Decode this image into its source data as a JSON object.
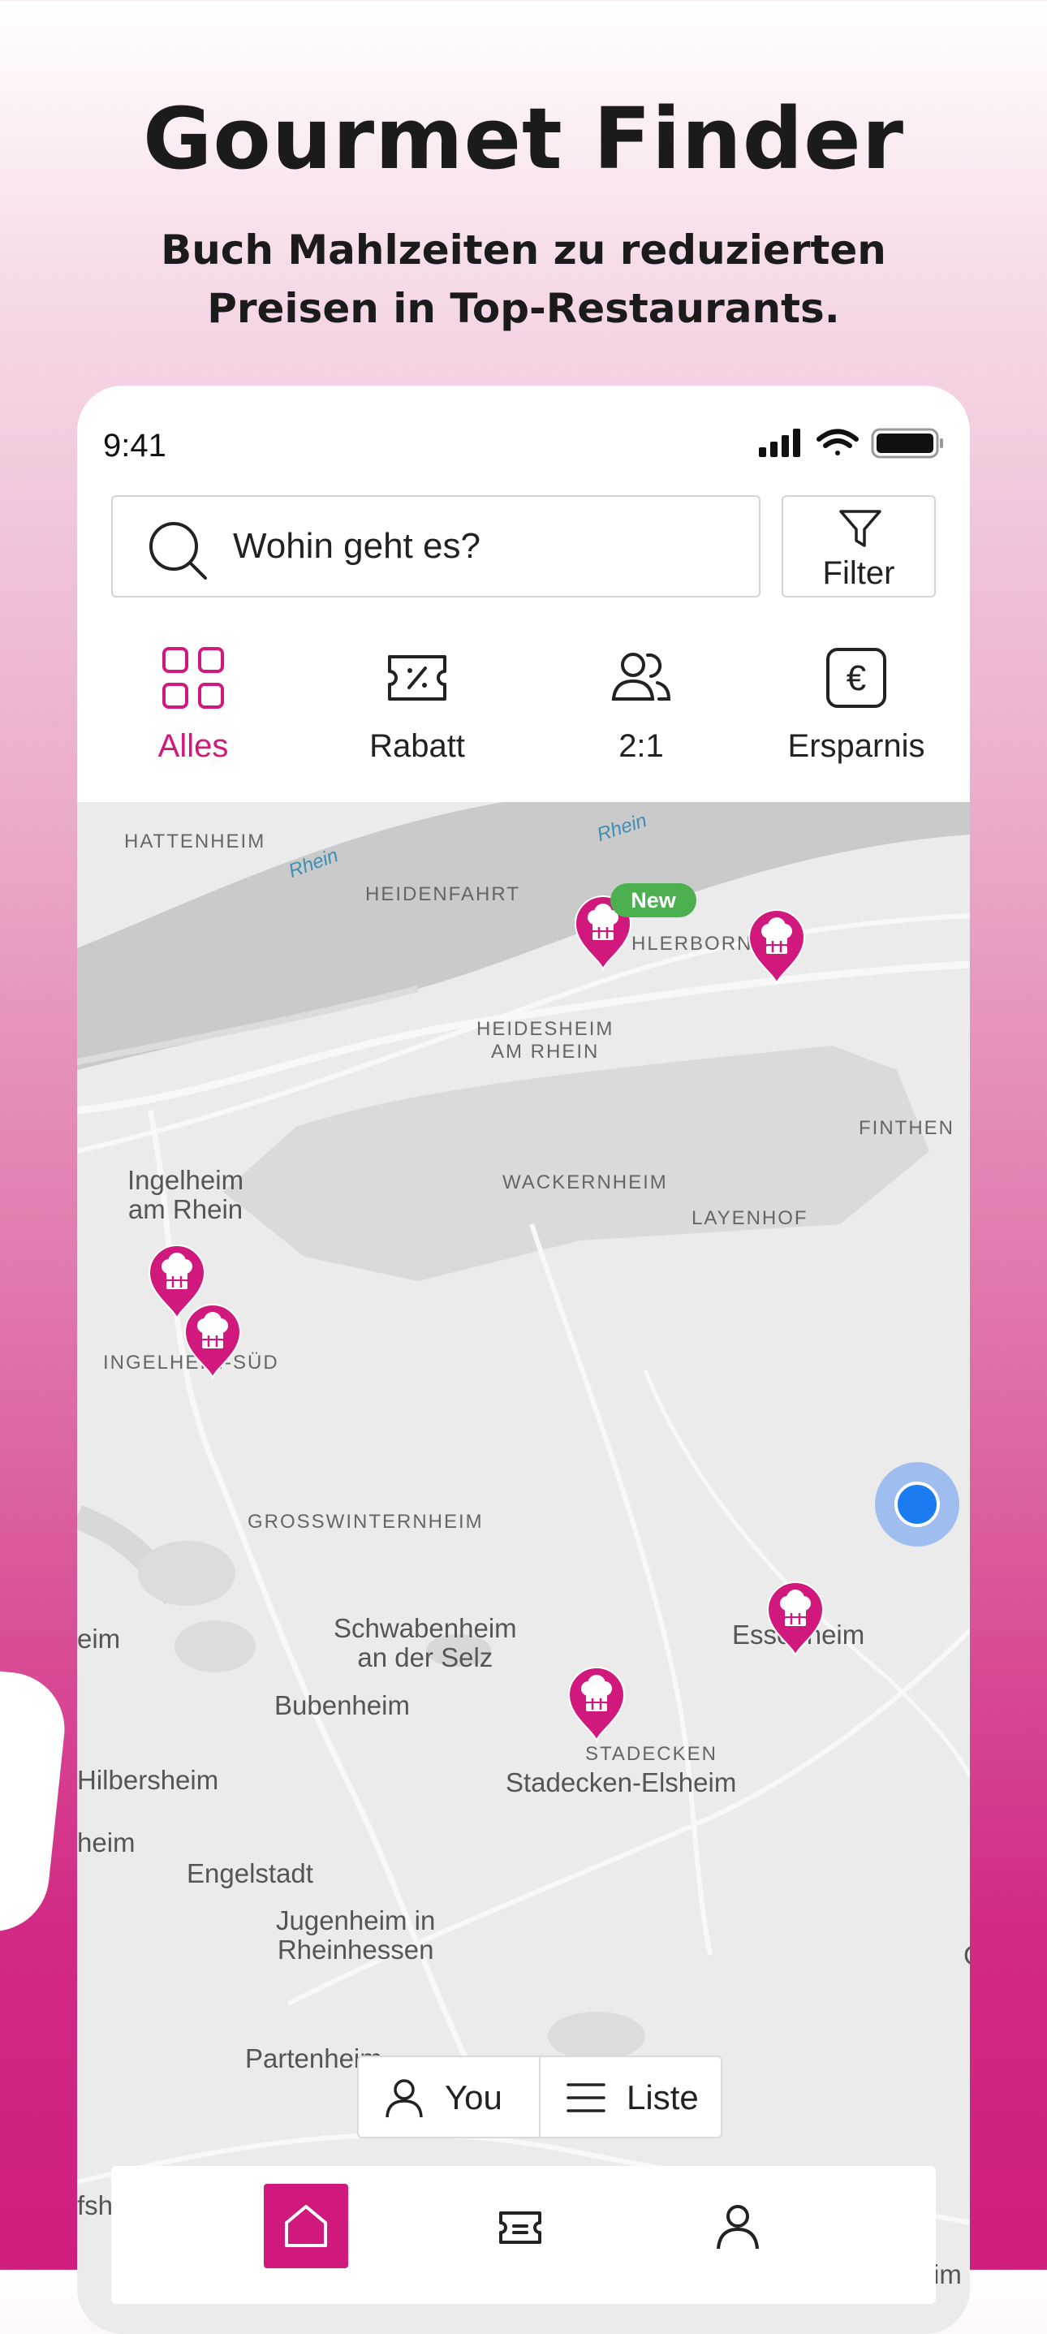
{
  "hero": {
    "title": "Gourmet Finder",
    "subtitle_line1": "Buch Mahlzeiten zu reduzierten",
    "subtitle_line2": "Preisen in Top-Restaurants."
  },
  "status_bar": {
    "time": "9:41"
  },
  "search": {
    "placeholder": "Wohin geht es?",
    "filter_label": "Filter"
  },
  "categories": [
    {
      "label": "Alles",
      "icon": "grid-icon",
      "active": true
    },
    {
      "label": "Rabatt",
      "icon": "discount-ticket-icon",
      "active": false
    },
    {
      "label": "2:1",
      "icon": "two-people-icon",
      "active": false
    },
    {
      "label": "Ersparnis",
      "icon": "euro-icon",
      "active": false
    }
  ],
  "map": {
    "places": {
      "hattenheim": "HATTENHEIM",
      "heidenfahrt": "HEIDENFAHRT",
      "uhlerborn": "HLERBORN",
      "heidesheim_1": "HEIDESHEIM",
      "heidesheim_2": "AM RHEIN",
      "wackernheim": "WACKERNHEIM",
      "layenhof": "LAYENHOF",
      "finthen": "FINTHEN",
      "ingelheim_sued": "INGELHEIM-SÜD",
      "grosswinternheim": "GROSSWINTERNHEIM",
      "stadecken": "STADECKEN",
      "ingelheim_1": "Ingelheim",
      "ingelheim_2": "am Rhein",
      "schwabenheim_1": "Schwabenheim",
      "schwabenheim_2": "an der Selz",
      "bubenheim": "Bubenheim",
      "essenheim": "Essenheim",
      "hilbersheim": "Hilbersheim",
      "stadecken_elsheim": "Stadecken-Elsheim",
      "engelstadt": "Engelstadt",
      "jugenheim_1": "Jugenheim in",
      "jugenheim_2": "Rheinhessen",
      "partenheim": "Partenheim",
      "left_heim_1": "eim",
      "left_heim_2": "heim",
      "left_fsh": "fsh",
      "right_edge": "G",
      "bottom_right": "im"
    },
    "river": {
      "name": "Rhein"
    },
    "new_badge": "New"
  },
  "toggles": {
    "you": "You",
    "list": "Liste"
  },
  "colors": {
    "accent": "#d0187d",
    "new_green": "#4caf50",
    "user_blue": "#1a7cf0"
  }
}
